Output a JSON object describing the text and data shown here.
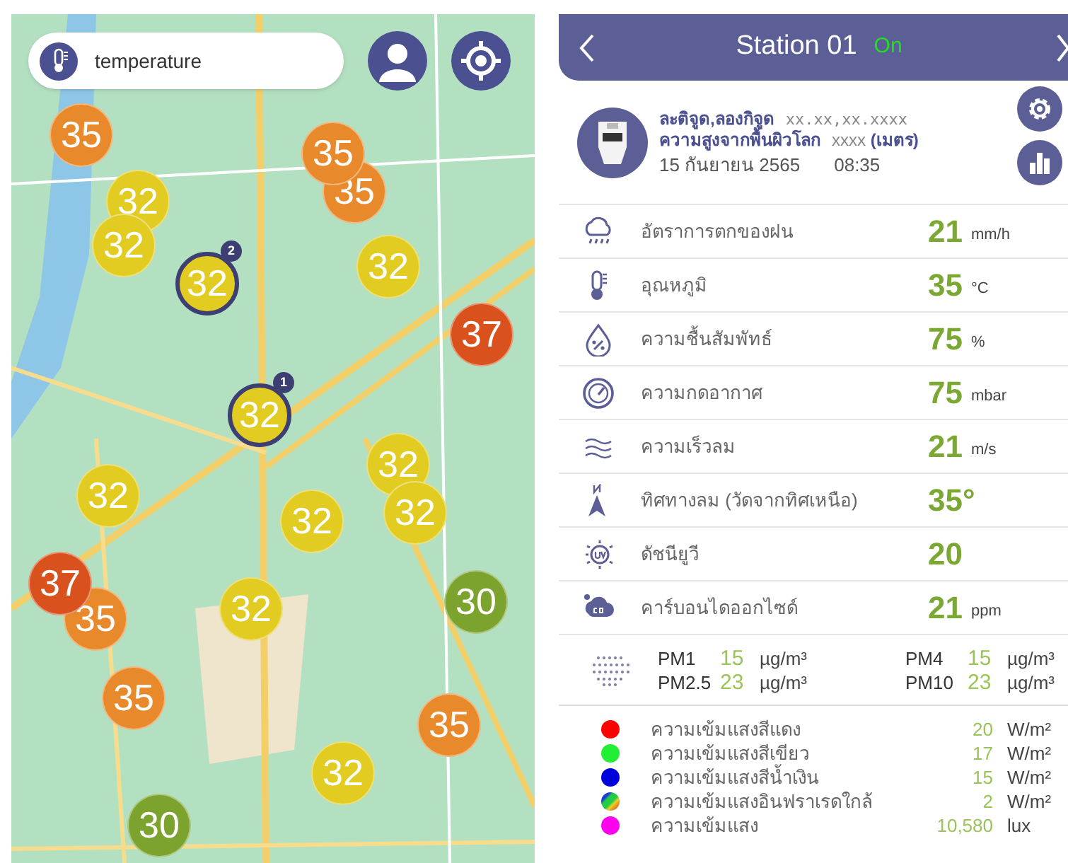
{
  "map": {
    "search": {
      "value": "temperature"
    },
    "markers": [
      {
        "kind": "station",
        "value": "35",
        "color": "#e8892c"
      },
      {
        "kind": "station",
        "value": "32",
        "color": "#e2cc22"
      },
      {
        "kind": "station",
        "value": "32",
        "color": "#e2cc22"
      },
      {
        "kind": "cluster",
        "value": "32",
        "color": "#e2cc22",
        "badge": "2"
      },
      {
        "kind": "station",
        "value": "35",
        "color": "#e8892c"
      },
      {
        "kind": "station",
        "value": "35",
        "color": "#e8892c"
      },
      {
        "kind": "station",
        "value": "32",
        "color": "#e2cc22"
      },
      {
        "kind": "station",
        "value": "37",
        "color": "#d9521e"
      },
      {
        "kind": "cluster",
        "value": "32",
        "color": "#e2cc22",
        "badge": "1"
      },
      {
        "kind": "station",
        "value": "32",
        "color": "#e2cc22"
      },
      {
        "kind": "station",
        "value": "32",
        "color": "#e2cc22"
      },
      {
        "kind": "station",
        "value": "32",
        "color": "#e2cc22"
      },
      {
        "kind": "station",
        "value": "32",
        "color": "#e2cc22"
      },
      {
        "kind": "station",
        "value": "35",
        "color": "#e8892c"
      },
      {
        "kind": "station",
        "value": "37",
        "color": "#d9521e"
      },
      {
        "kind": "station",
        "value": "32",
        "color": "#e2cc22"
      },
      {
        "kind": "station",
        "value": "30",
        "color": "#7ba32d"
      },
      {
        "kind": "station",
        "value": "35",
        "color": "#e8892c"
      },
      {
        "kind": "station",
        "value": "35",
        "color": "#e8892c"
      },
      {
        "kind": "station",
        "value": "32",
        "color": "#e2cc22"
      },
      {
        "kind": "station",
        "value": "30",
        "color": "#7ba32d"
      }
    ]
  },
  "station": {
    "title": "Station 01",
    "status": {
      "label": "On",
      "on": true
    },
    "coords_label": "ละติจูด,ลองกิจูด",
    "coords_value": "xx.xx,xx.xxxx",
    "altitude_label": "ความสูงจากพื้นผิวโลก",
    "altitude_value": "xxxx **(เมตร)**",
    "date": "15 กันยายน 2565",
    "time": "08:35",
    "readings": [
      {
        "kind": "rain",
        "label": "อัตราการตกของฝน",
        "value": "21",
        "unit": "mm/h"
      },
      {
        "kind": "temperature",
        "label": "อุณหภูมิ",
        "value": "35",
        "unit": "°C"
      },
      {
        "kind": "humidity",
        "label": "ความชื้นสัมพัทธ์",
        "value": "75",
        "unit": "%"
      },
      {
        "kind": "pressure",
        "label": "ความกดอากาศ",
        "value": "75",
        "unit": "mbar"
      },
      {
        "kind": "wind",
        "label": "ความเร็วลม",
        "value": "21",
        "unit": "m/s"
      },
      {
        "kind": "direction",
        "label": "ทิศทางลม (วัดจากทิศเหนือ)",
        "value": "35°"
      },
      {
        "kind": "uv",
        "label": "ดัชนียูวี",
        "value": "20"
      },
      {
        "kind": "co2",
        "label": "คาร์บอนไดออกไซด์",
        "value": "21",
        "unit": "ppm"
      }
    ],
    "pm": [
      {
        "label": "PM1",
        "value": "15",
        "unit": "µg/m³"
      },
      {
        "label": "PM4",
        "value": "15",
        "unit": "µg/m³"
      },
      {
        "label": "PM2.5",
        "value": "23",
        "unit": "µg/m³"
      },
      {
        "label": "PM10",
        "value": "23",
        "unit": "µg/m³"
      }
    ],
    "light": [
      {
        "kind": "dot",
        "color": "#ff0000",
        "label": "ความเข้มแสงสีแดง",
        "value": "20",
        "unit": "W/m²"
      },
      {
        "kind": "dot",
        "color": "#22ee33",
        "label": "ความเข้มแสงสีเขียว",
        "value": "17",
        "unit": "W/m²"
      },
      {
        "kind": "dot",
        "color": "#0000dd",
        "label": "ความเข้มแสงสีน้ำเงิน",
        "value": "15",
        "unit": "W/m²"
      },
      {
        "kind": "spectrum",
        "label": "ความเข้มแสงอินฟราเรดใกล้",
        "value": "2",
        "unit": "W/m²"
      },
      {
        "kind": "dot",
        "color": "#ff00ee",
        "label": "ความเข้มแสง",
        "value": "10,580",
        "unit": "lux"
      }
    ]
  }
}
